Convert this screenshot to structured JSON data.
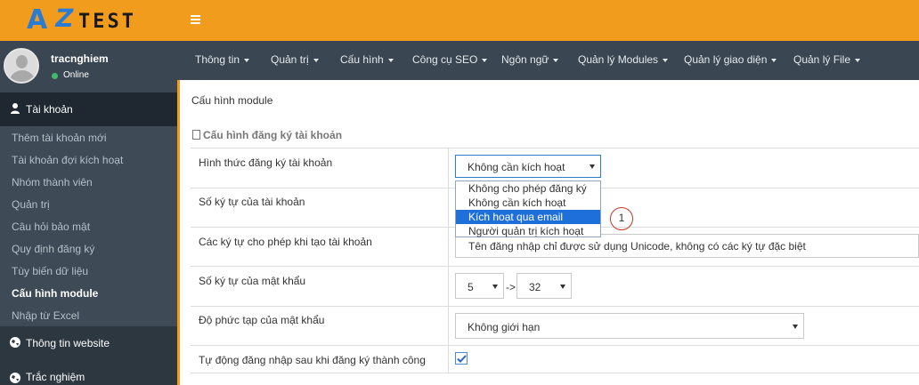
{
  "logo": {
    "mark": "A",
    "z": "Z",
    "word": "TEST"
  },
  "user": {
    "name": "tracnghiem",
    "status": "Online"
  },
  "sidebar": {
    "account_header": "Tài khoản",
    "items": [
      {
        "label": "Thêm tài khoản mới"
      },
      {
        "label": "Tài khoản đợi kích hoạt"
      },
      {
        "label": "Nhóm thành viên"
      },
      {
        "label": "Quản trị"
      },
      {
        "label": "Câu hỏi bảo mật"
      },
      {
        "label": "Quy định đăng ký"
      },
      {
        "label": "Tùy biến dữ liệu"
      },
      {
        "label": "Cấu hình module",
        "active": true
      },
      {
        "label": "Nhập từ Excel"
      }
    ],
    "website_header": "Thông tin website",
    "test_header": "Trắc nghiệm"
  },
  "nav": {
    "items": [
      {
        "label": "Thông tin"
      },
      {
        "label": "Quản trị"
      },
      {
        "label": "Cấu hình"
      },
      {
        "label": "Công cụ SEO"
      },
      {
        "label": "Ngôn ngữ"
      },
      {
        "label": "Quản lý Modules"
      },
      {
        "label": "Quản lý giao diện"
      },
      {
        "label": "Quản lý File"
      }
    ]
  },
  "main": {
    "breadcrumb": "Cấu hình module",
    "section_title": "Cấu hình đăng ký tài khoản",
    "rows": [
      {
        "label": "Hình thức đăng ký tài khoản"
      },
      {
        "label": "Số ký tự của tài khoản"
      },
      {
        "label": "Các ký tự cho phép khi tạo tài khoản"
      },
      {
        "label": "Số ký tự của mật khẩu"
      },
      {
        "label": "Độ phức tạp của mật khẩu"
      },
      {
        "label": "Tự động đăng nhập sau khi đăng ký thành công"
      }
    ],
    "registration_select": {
      "value": "Không cần kích hoạt",
      "options": [
        "Không cho phép đăng ký",
        "Không cần kích hoạt",
        "Kích hoạt qua email",
        "Người quản trị kích hoạt"
      ],
      "highlighted": "Kích hoạt qua email"
    },
    "allowed_chars_value": "Tên đăng nhập chỉ được sử dụng Unicode, không có các ký tự đặc biệt",
    "password_min": "5",
    "password_range_sep": "->",
    "password_max": "32",
    "password_complexity": "Không giới hạn",
    "auto_login_checked": true,
    "annotation_number": "1"
  },
  "colors": {
    "accent_orange": "#f29c1d",
    "sidebar_dark": "#34404b",
    "highlight_blue": "#1e6fd9"
  }
}
